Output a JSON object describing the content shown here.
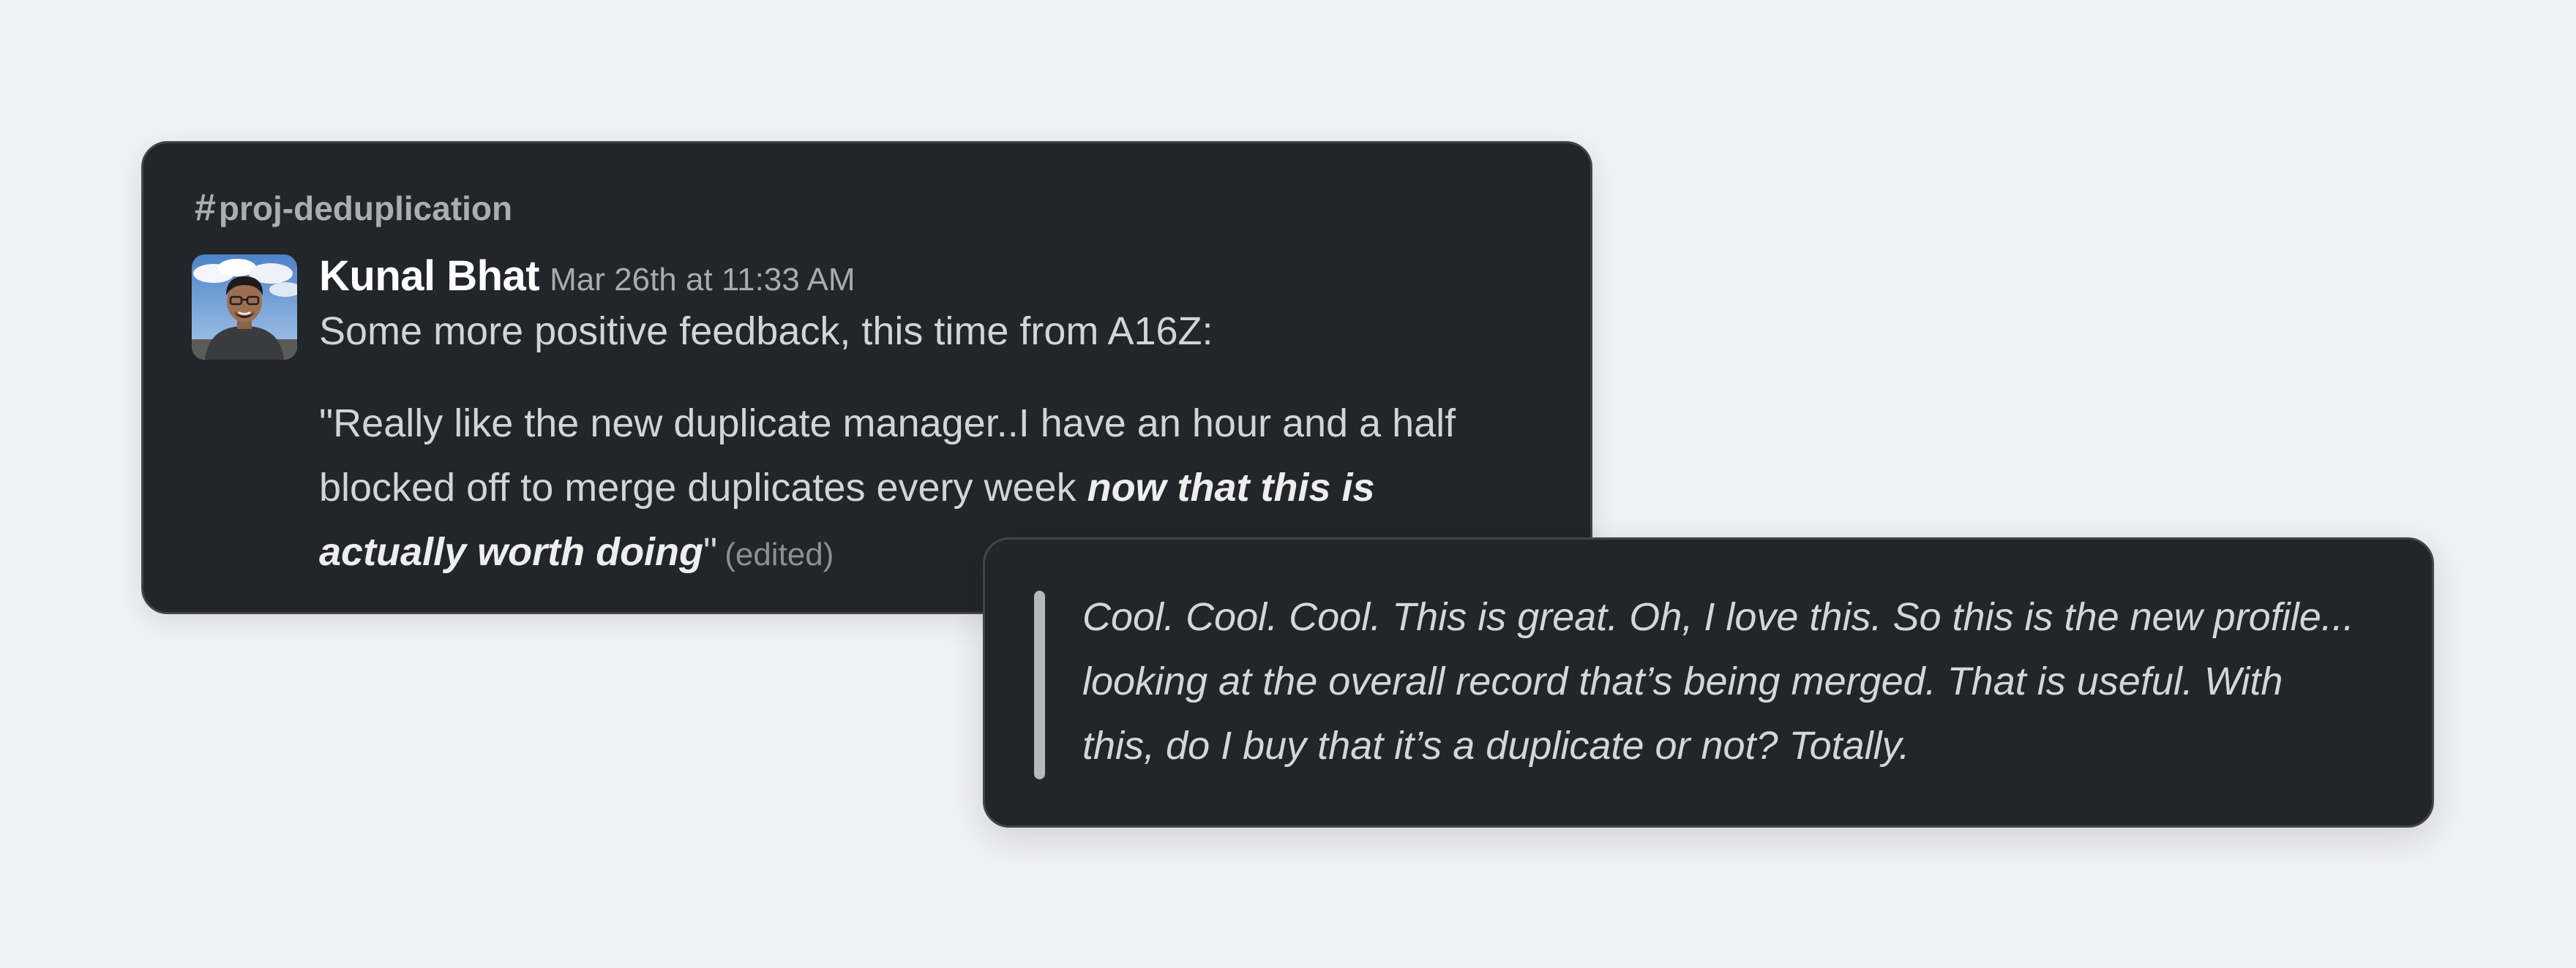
{
  "message": {
    "channel": "proj-deduplication",
    "channel_prefix": "#",
    "author": "Kunal Bhat",
    "timestamp": "Mar 26th at 11:33 AM",
    "intro": "Some more positive feedback, this time from A16Z:",
    "quote_open": "\"Really like the new duplicate manager..I have an hour and a half blocked off to merge duplicates every week ",
    "quote_emphasis": "now that this is actually worth doing",
    "quote_close": "\"",
    "edited_label": "(edited)",
    "avatar_icon": "user-photo-avatar"
  },
  "reply": {
    "lines": [
      "Cool. Cool. Cool. This is great. Oh, I love this. So this is the new profile...",
      "looking at the overall record that’s being merged. That is useful. With",
      "this, do I buy that it’s a duplicate or not? Totally."
    ]
  },
  "colors": {
    "page_background": "#f0f1f5",
    "card_background": "#222529",
    "card_border": "#41444a",
    "author_text": "#ffffff",
    "body_text": "#d3d4d6",
    "muted_text": "#a9abaf",
    "quote_bar": "#b7b8bb"
  }
}
